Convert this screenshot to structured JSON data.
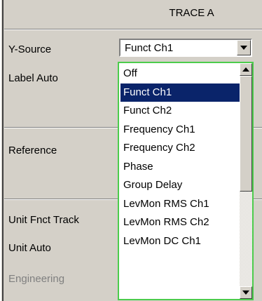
{
  "header": {
    "title": "TRACE A"
  },
  "fields": {
    "y_source": "Y-Source",
    "label_auto": "Label Auto",
    "reference": "Reference",
    "unit_fnct_track": "Unit Fnct Track",
    "unit_auto": "Unit Auto",
    "engineering": "Engineering"
  },
  "combo": {
    "value": "Funct Ch1",
    "options": [
      "Off",
      "Funct Ch1",
      "Funct Ch2",
      "Frequency Ch1",
      "Frequency Ch2",
      "Phase",
      "Group Delay",
      "LevMon RMS Ch1",
      "LevMon RMS Ch2",
      "LevMon DC Ch1"
    ],
    "selected_index": 1
  },
  "scrollbar": {
    "thumb_fraction": 0.55
  },
  "colors": {
    "panel": "#d4d0c8",
    "selection": "#0a246a",
    "focus_border": "#4ccc4c"
  },
  "icons": {
    "combo_arrow": "triangle-down-icon",
    "scroll_up": "triangle-up-icon",
    "scroll_down": "triangle-down-icon"
  }
}
